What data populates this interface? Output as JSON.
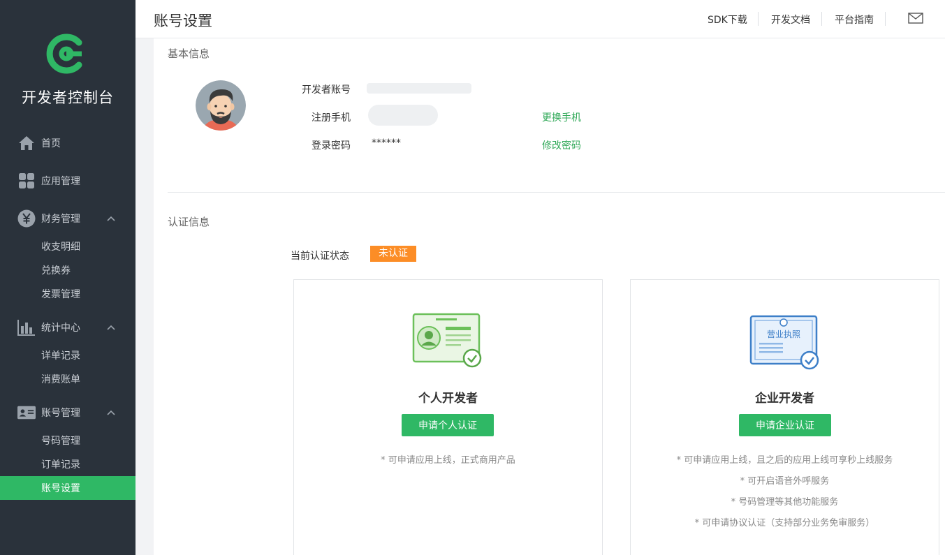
{
  "sidebar": {
    "brand": "开发者控制台",
    "nav": [
      {
        "label": "首页",
        "icon": "home-icon"
      },
      {
        "label": "应用管理",
        "icon": "grid-icon"
      },
      {
        "label": "财务管理",
        "icon": "yuan-icon",
        "expanded": true,
        "children": [
          "收支明细",
          "兑换券",
          "发票管理"
        ]
      },
      {
        "label": "统计中心",
        "icon": "bar-chart-icon",
        "expanded": true,
        "children": [
          "详单记录",
          "消费账单"
        ]
      },
      {
        "label": "账号管理",
        "icon": "id-card-icon",
        "expanded": true,
        "children": [
          "号码管理",
          "订单记录",
          "账号设置"
        ]
      }
    ],
    "active": "账号设置",
    "accent": "#2fb865"
  },
  "header": {
    "title": "账号设置",
    "links": [
      "SDK下载",
      "开发文档",
      "平台指南"
    ],
    "mail_icon": "mail-icon"
  },
  "basic": {
    "section_title": "基本信息",
    "account_label": "开发者账号",
    "phone_label": "注册手机",
    "password_label": "登录密码",
    "password_value": "******",
    "change_phone": "更换手机",
    "change_password": "修改密码"
  },
  "cert": {
    "section_title": "认证信息",
    "status_label": "当前认证状态",
    "status_value": "未认证",
    "status_color": "#fc8d26",
    "personal": {
      "title": "个人开发者",
      "button": "申请个人认证",
      "notes": [
        "* 可申请应用上线，正式商用产品"
      ]
    },
    "enterprise": {
      "title": "企业开发者",
      "button": "申请企业认证",
      "license_text": "营业执照",
      "notes": [
        "* 可申请应用上线，且之后的应用上线可享秒上线服务",
        "* 可开启语音外呼服务",
        "* 号码管理等其他功能服务",
        "* 可申请协议认证（支持部分业务免审服务）"
      ]
    }
  }
}
